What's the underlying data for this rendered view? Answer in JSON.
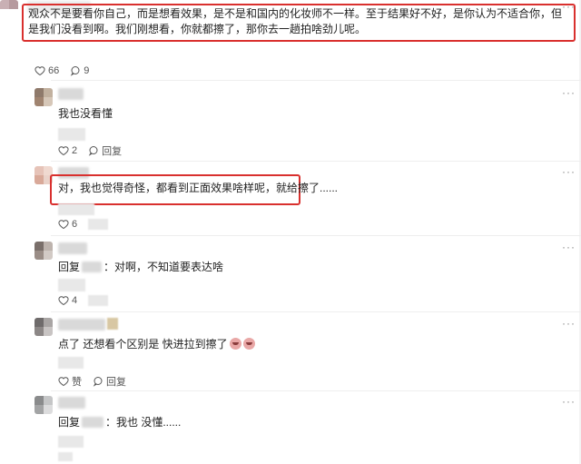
{
  "comments": [
    {
      "text": "观众不是要看你自己，而是想看效果，是不是和国内的化妆师不一样。至于结果好不好，是你认为不适合你，但是我们没看到啊。我们刚想看，你就都擦了，那你去一趟拍啥劲儿呢。",
      "likes": "66",
      "replies": "9"
    },
    {
      "text": "我也没看懂",
      "likes": "2",
      "reply_label": "回复"
    },
    {
      "text": "对，我也觉得奇怪，都看到正面效果啥样呢，就给擦了......",
      "likes": "6"
    },
    {
      "reply_prefix": "回复",
      "text": "：对啊，不知道要表达啥",
      "likes": "4"
    },
    {
      "text": "点了 还想看个区别是 快进拉到擦了",
      "likes_label": "赞",
      "reply_label": "回复"
    },
    {
      "reply_prefix": "回复",
      "text": "：我也 没懂......"
    }
  ],
  "more_label": "···",
  "icons": {
    "like": "heart-outline-icon",
    "comment": "speech-bubble-icon",
    "more": "more-dots-icon",
    "emoji": "blush-face-emoji-icon"
  },
  "colors": {
    "highlight": "#d9302e",
    "text": "#222222",
    "muted": "#555555"
  }
}
